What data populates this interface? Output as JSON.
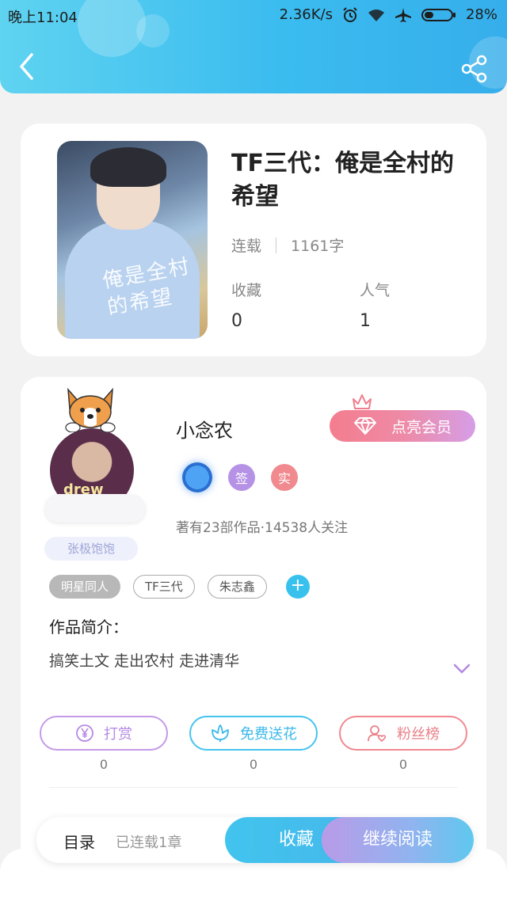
{
  "status_bar": {
    "time": "晚上11:04",
    "speed": "2.36K/s",
    "battery": "28%"
  },
  "header": {
    "back_icon": "chevron-left-icon",
    "share_icon": "share-icon"
  },
  "book": {
    "title": "TF三代：俺是全村的希望",
    "cover_text": "俺是全村的希望",
    "status": "连载",
    "word_count": "1161字",
    "favorites_label": "收藏",
    "favorites_value": "0",
    "popularity_label": "人气",
    "popularity_value": "1"
  },
  "author": {
    "name": "小念农",
    "avatar_caption": "张极饱饱",
    "vip_button": "点亮会员",
    "badge_sign": "签",
    "badge_real": "实",
    "stats": "著有23部作品·14538人关注",
    "tags": [
      "明星同人",
      "TF三代",
      "朱志鑫"
    ],
    "tag_add": "+",
    "intro_label": "作品简介：",
    "intro_text": "搞笑土文 走出农村 走进清华"
  },
  "actions": {
    "reward_label": "打赏",
    "reward_count": "0",
    "flower_label": "免费送花",
    "flower_count": "0",
    "fans_label": "粉丝榜",
    "fans_count": "0"
  },
  "bottom_bar": {
    "toc_label": "目录",
    "toc_sub": "已连载1章",
    "favorite_button": "收藏",
    "continue_button": "继续阅读"
  },
  "colors": {
    "header_start": "#5fd3f0",
    "header_end": "#36aeeb",
    "accent_blue": "#42c4ee",
    "accent_purple": "#b99be8",
    "accent_pink": "#f47d8e"
  }
}
